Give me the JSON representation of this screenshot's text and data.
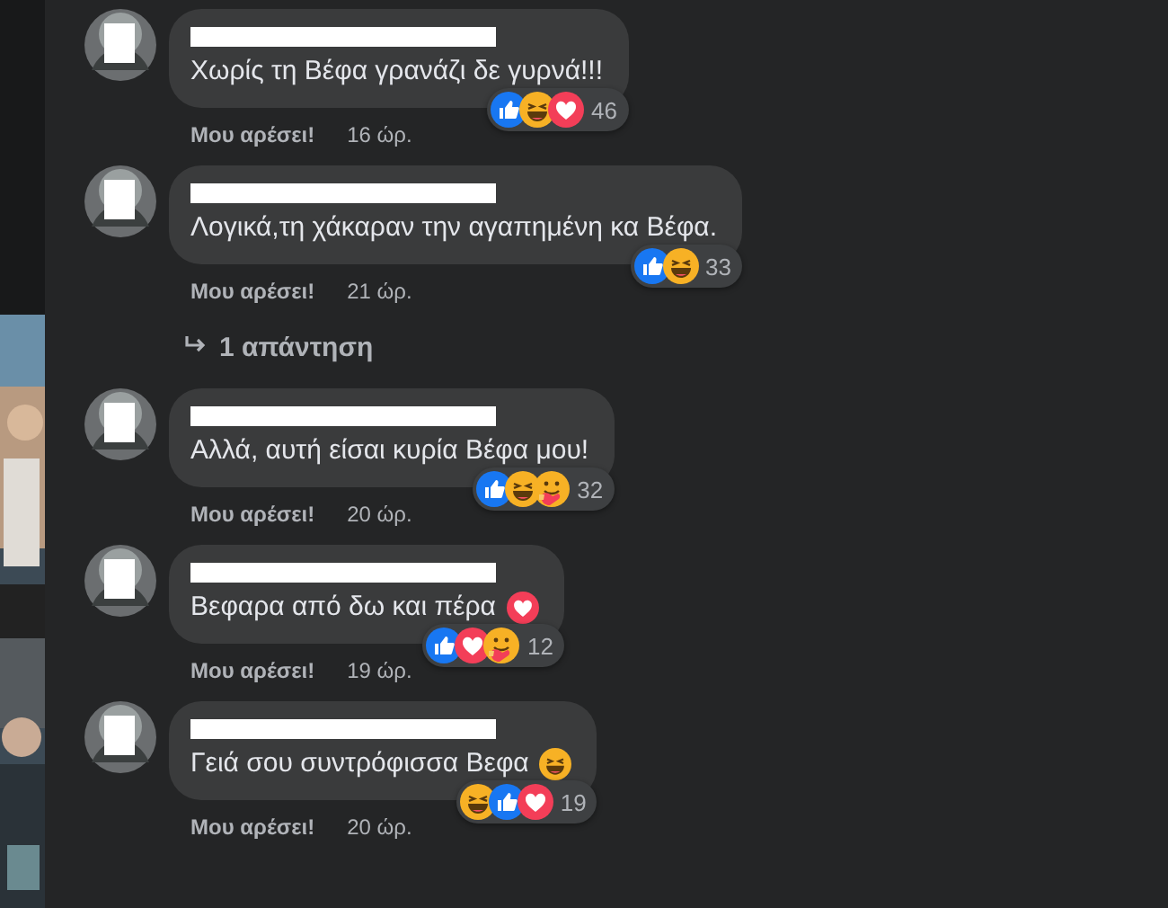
{
  "comments": [
    {
      "text": "Χωρίς τη Βέφα γρανάζι δε γυρνά!!!",
      "like_label": "Μου αρέσει!",
      "time": "16 ώρ.",
      "reactions": [
        {
          "kind": "like"
        },
        {
          "kind": "haha"
        },
        {
          "kind": "love"
        }
      ],
      "reaction_count": "46"
    },
    {
      "text": "Λογικά,τη χάκαραν την αγαπημένη κα Βέφα.",
      "like_label": "Μου αρέσει!",
      "time": "21 ώρ.",
      "reactions": [
        {
          "kind": "like"
        },
        {
          "kind": "haha"
        }
      ],
      "reaction_count": "33",
      "replies": "1 απάντηση"
    },
    {
      "text": "Αλλά, αυτή είσαι κυρία Βέφα μου!",
      "like_label": "Μου αρέσει!",
      "time": "20 ώρ.",
      "reactions": [
        {
          "kind": "like"
        },
        {
          "kind": "haha"
        },
        {
          "kind": "care"
        }
      ],
      "reaction_count": "32"
    },
    {
      "text": "Βεφαρα από δω και πέρα",
      "inline_emoji": {
        "kind": "love"
      },
      "like_label": "Μου αρέσει!",
      "time": "19 ώρ.",
      "reactions": [
        {
          "kind": "like"
        },
        {
          "kind": "love"
        },
        {
          "kind": "care"
        }
      ],
      "reaction_count": "12"
    },
    {
      "text": "Γειά σου συντρόφισσα Βεφα",
      "inline_emoji": {
        "kind": "haha"
      },
      "like_label": "Μου αρέσει!",
      "time": "20 ώρ.",
      "reactions": [
        {
          "kind": "haha"
        },
        {
          "kind": "like"
        },
        {
          "kind": "love"
        }
      ],
      "reaction_count": "19"
    }
  ]
}
